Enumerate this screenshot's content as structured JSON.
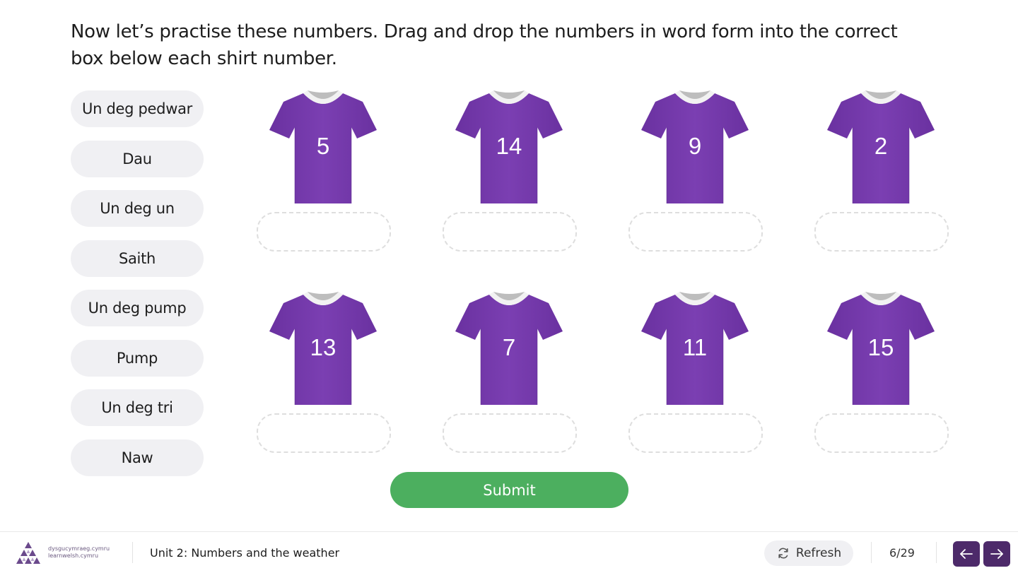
{
  "instruction": "Now let’s practise these numbers. Drag and drop the numbers in word form into the correct box below each shirt number.",
  "words": [
    "Un deg pedwar",
    "Dau",
    "Un deg un",
    "Saith",
    "Un deg pump",
    "Pump",
    "Un deg tri",
    "Naw"
  ],
  "shirts": [
    "5",
    "14",
    "9",
    "2",
    "13",
    "7",
    "11",
    "15"
  ],
  "colors": {
    "shirt": "#7b3fb2",
    "submit": "#4caf5f",
    "nav": "#4d2a6a"
  },
  "submit_label": "Submit",
  "footer": {
    "logo_line1": "dysgucymraeg.cymru",
    "logo_line2": "learnwelsh.cymru",
    "unit_title": "Unit 2: Numbers and the weather",
    "refresh_label": "Refresh",
    "page": "6/29",
    "prev_icon": "arrow-left-icon",
    "next_icon": "arrow-right-icon"
  }
}
